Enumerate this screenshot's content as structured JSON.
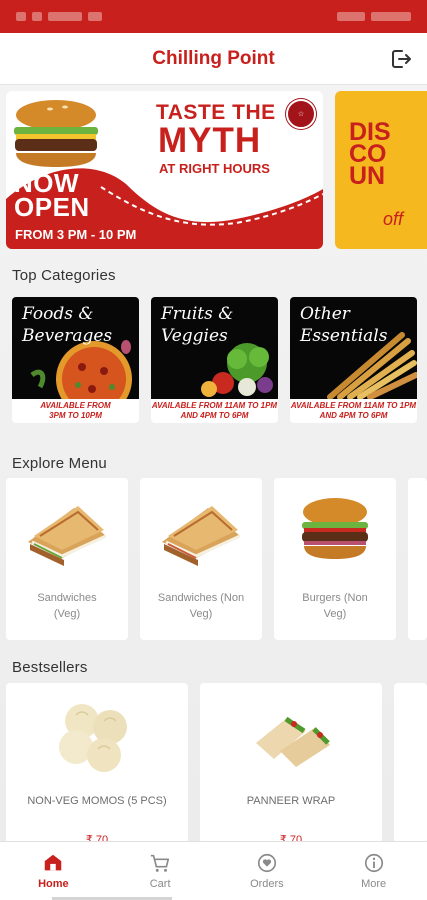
{
  "app": {
    "title": "Chilling Point",
    "accent_color": "#c8201c"
  },
  "banners": [
    {
      "taste_text": "TASTE THE",
      "myth_text": "MYTH",
      "right_hours_text": "AT RIGHT HOURS",
      "now_open_line1": "NOW",
      "now_open_line2": "OPEN",
      "hours_text": "FROM 3 PM - 10 PM"
    },
    {
      "text_line1": "DIS",
      "text_line2": "CO",
      "text_line3": "UN",
      "text_line4": "OFF",
      "off_text": "off"
    }
  ],
  "top_categories": {
    "title": "Top Categories",
    "items": [
      {
        "title_line1": "Foods &",
        "title_line2": "Beverages",
        "avail_line1": "AVAILABLE FROM",
        "avail_line2": "3PM TO 10PM"
      },
      {
        "title_line1": "Fruits &",
        "title_line2": "Veggies",
        "avail_line1": "AVAILABLE FROM 11AM TO 1PM",
        "avail_line2": "AND 4PM TO 6PM"
      },
      {
        "title_line1": "Other",
        "title_line2": "Essentials",
        "avail_line1": "AVAILABLE FROM 11AM TO 1PM",
        "avail_line2": "AND 4PM TO 6PM"
      }
    ]
  },
  "explore_menu": {
    "title": "Explore Menu",
    "items": [
      {
        "line1": "Sandwiches",
        "line2": "(Veg)",
        "icon": "sandwich-icon"
      },
      {
        "line1": "Sandwiches (Non",
        "line2": "Veg)",
        "icon": "sandwich-icon"
      },
      {
        "line1": "Burgers (Non",
        "line2": "Veg)",
        "icon": "burger-icon"
      }
    ]
  },
  "bestsellers": {
    "title": "Bestsellers",
    "items": [
      {
        "name": "NON-VEG MOMOS (5 PCS)",
        "price": "₹ 70",
        "icon": "momos-icon"
      },
      {
        "name": "PANNEER WRAP",
        "price": "₹ 70",
        "icon": "wrap-icon"
      }
    ]
  },
  "bottom_nav": [
    {
      "label": "Home",
      "icon": "home-icon",
      "active": true
    },
    {
      "label": "Cart",
      "icon": "cart-icon",
      "active": false
    },
    {
      "label": "Orders",
      "icon": "orders-icon",
      "active": false
    },
    {
      "label": "More",
      "icon": "more-icon",
      "active": false
    }
  ]
}
